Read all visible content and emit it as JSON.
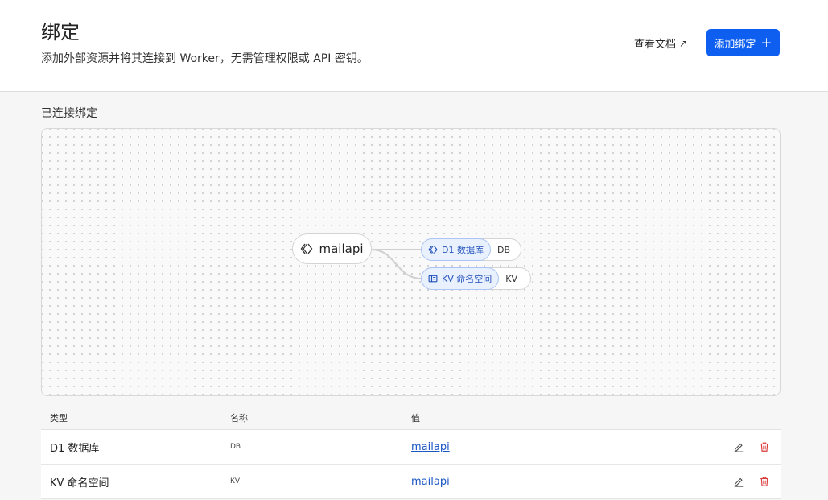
{
  "header": {
    "title": "绑定",
    "subtitle": "添加外部资源并将其连接到 Worker，无需管理权限或 API 密钥。",
    "docs_label": "查看文档",
    "docs_icon": "external-link-icon",
    "add_button_label": "添加绑定",
    "add_button_icon": "plus-icon",
    "accent_color": "#0e5ff0"
  },
  "connected": {
    "section_title": "已连接绑定",
    "worker_node": {
      "label": "mailapi",
      "icon": "worker-code-icon"
    },
    "bindings": [
      {
        "type_label": "D1 数据库",
        "name": "DB",
        "icon": "d1-database-icon"
      },
      {
        "type_label": "KV 命名空间",
        "name": "KV",
        "icon": "kv-namespace-icon"
      }
    ]
  },
  "table": {
    "headers": {
      "type": "类型",
      "name": "名称",
      "value": "值"
    },
    "rows": [
      {
        "type": "D1 数据库",
        "name": "DB",
        "value": "mailapi",
        "edit_icon": "edit-icon",
        "delete_icon": "trash-icon"
      },
      {
        "type": "KV 命名空间",
        "name": "KV",
        "value": "mailapi",
        "edit_icon": "edit-icon",
        "delete_icon": "trash-icon"
      }
    ],
    "delete_color": "#d93a3a"
  }
}
